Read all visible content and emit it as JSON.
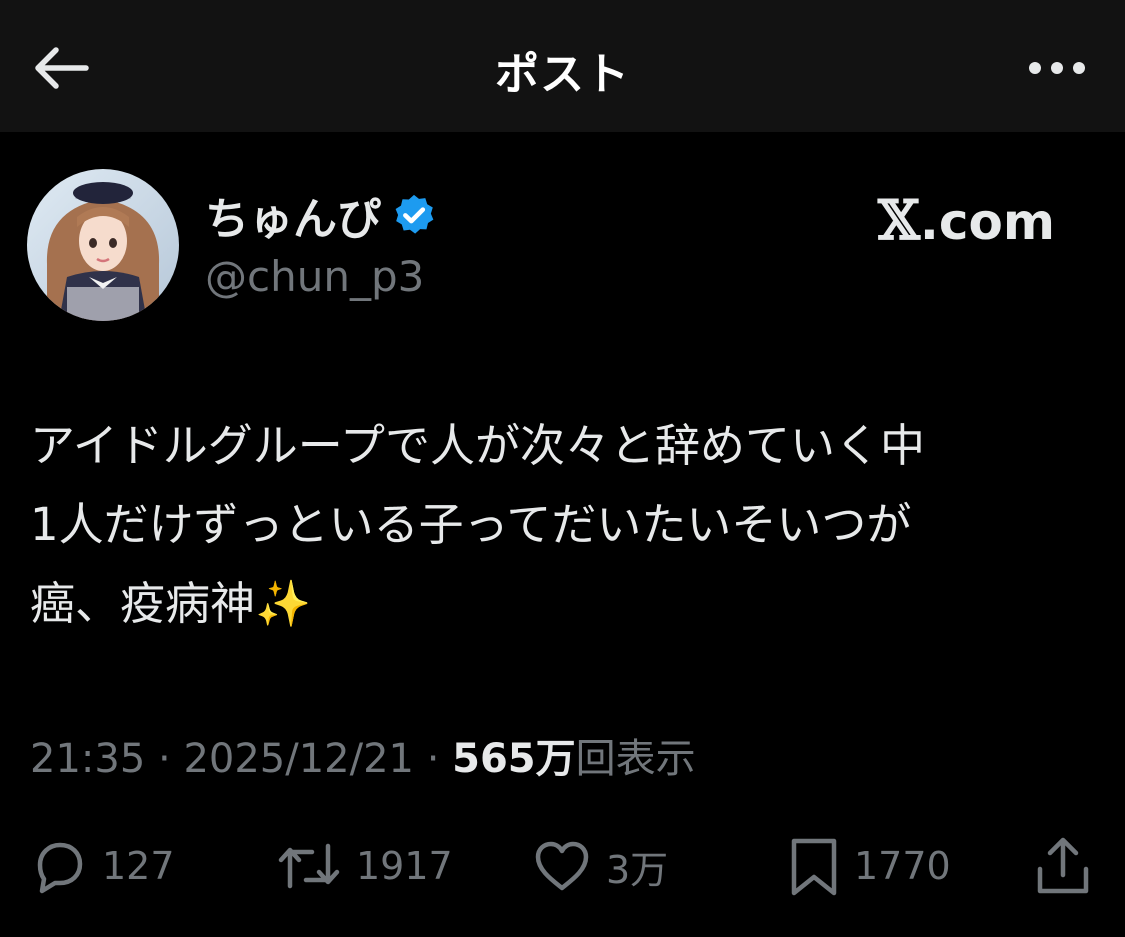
{
  "header": {
    "title": "ポスト",
    "back_icon": "arrow-left-icon",
    "more_icon": "more-horizontal-icon"
  },
  "author": {
    "display_name": "ちゅんぴ",
    "handle": "@chun_p3",
    "verified_icon": "verified-badge-icon",
    "verified_color": "#1d9bf0"
  },
  "site_mark": {
    "glyph": "𝕏",
    "text": ".com"
  },
  "post": {
    "lines": [
      "アイドルグループで人が次々と辞めていく中",
      "1人だけずっといる子ってだいたいそいつが",
      "癌、疫病神"
    ],
    "emoji": "✨"
  },
  "meta": {
    "time": "21:35",
    "sep1": " · ",
    "date": "2025/12/21",
    "sep2": " · ",
    "views_count": "565万",
    "views_label": "回表示"
  },
  "actions": {
    "reply_count": "127",
    "repost_count": "1917",
    "like_count": "3万",
    "bookmark_count": "1770"
  },
  "colors": {
    "background": "#000000",
    "header_bg": "#121212",
    "text_primary": "#e7e9ea",
    "text_secondary": "#71767b"
  }
}
